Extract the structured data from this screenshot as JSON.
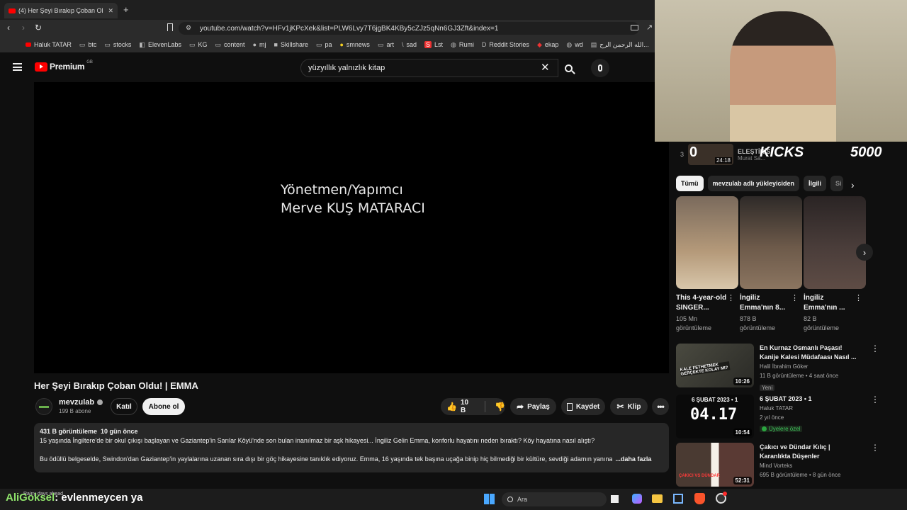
{
  "browser": {
    "tab_title": "(4) Her Şeyi Bırakıp Çoban Ol",
    "url": "youtube.com/watch?v=HFv1jKPcXek&list=PLW6Lvy7T6jgBK4KBy5cZJz5qNn6GJ3Zft&index=1",
    "bookmarks": [
      "Haluk TATAR",
      "btc",
      "stocks",
      "ElevenLabs",
      "KG",
      "content",
      "mj",
      "Skillshare",
      "pa",
      "smnews",
      "art",
      "sad",
      "Lst",
      "Rumi",
      "Reddit Stories",
      "ekap",
      "wd",
      "الله الرحمن الرح..."
    ]
  },
  "header": {
    "logo": "Premium",
    "region": "GB",
    "search_value": "yüzyıllık yalnızlık kitap"
  },
  "video": {
    "credit_line1": "Yönetmen/Yapımcı",
    "credit_line2": "Merve KUŞ MATARACI",
    "title": "Her Şeyi Bırakıp Çoban Oldu! | EMMA",
    "channel": "mevzulab",
    "subscribers": "199 B abone",
    "join": "Katıl",
    "subscribe": "Abone ol",
    "likes": "10 B",
    "share": "Paylaş",
    "save": "Kaydet",
    "clip": "Klip"
  },
  "description": {
    "stats": "431 B görüntüleme  10 gün önce",
    "line1": "15 yaşında İngiltere'de bir okul çıkışı başlayan ve Gaziantep'in Sarılar Köyü'nde son bulan inanılmaz bir aşk hikayesi... İngiliz Gelin Emma, konforlu hayatını neden bıraktı? Köy hayatına nasıl alıştı?",
    "line2": "Bu ödüllü belgeselde, Swindon'dan Gaziantep'in yaylalarına uzanan sıra dışı bir göç hikayesine tanıklık ediyoruz. Emma, 16 yaşında tek başına uçağa binip hiç bilmediği bir kültüre, sevdiği adamın yanına",
    "more": "...daha fazla"
  },
  "sidebar": {
    "top_item": {
      "index": "3",
      "title": "ELEŞTİRİSİ",
      "channel": "Murat Sa...",
      "duration": "24:18"
    },
    "chips": [
      "Tümü",
      "mevzulab adlı yükleyiciden",
      "İlgili",
      "Si"
    ],
    "shorts": [
      {
        "title": "This 4-year-old SINGER...",
        "views": "105 Mn görüntüleme",
        "color": "#b59a7a"
      },
      {
        "title": "İngiliz Emma'nın 8...",
        "views": "878 B görüntüleme",
        "color": "#6d5a4a"
      },
      {
        "title": "İngiliz Emma'nın ...",
        "views": "82 B görüntüleme",
        "color": "#4a3d3a"
      }
    ],
    "videos": [
      {
        "title": "En Kurnaz Osmanlı Paşası! Kanije Kalesi Müdafaası Nasıl ...",
        "channel": "Halil İbrahim Göker",
        "meta": "11 B görüntüleme • 4 saat önce",
        "badge": "Yeni",
        "duration": "10:26",
        "thumb_text": "KALE FETHETMEK GERÇEKTE KOLAY MI?"
      },
      {
        "title": "6 ŞUBAT 2023 • 1",
        "channel": "Haluk TATAR",
        "meta": "2 yıl önce",
        "badge": "Üyelere özel",
        "duration": "10:54",
        "thumb_text": "6 ŞUBAT 2023 • 1",
        "thumb_big": "04.17"
      },
      {
        "title": "Çakıcı ve Dündar Kılıç | Karanlıkta Düşenler",
        "channel": "Mind Vorteks",
        "meta": "695 B görüntüleme • 8 gün önce",
        "badge": "",
        "duration": "52:31",
        "thumb_text": "ÇAKICI VS DÜNDAR"
      }
    ]
  },
  "webcam": {
    "overlay_left": "KICKS",
    "overlay_right": "5000",
    "overlay_zero": "0"
  },
  "taskbar": {
    "notification": "Rainy days ahead",
    "search": "Ara",
    "streamer": "AliGoksel",
    "ticker": ": evlenmeycen ya"
  },
  "colors": {
    "accent_red": "#ff0000",
    "chip_active_bg": "#f1f1f1",
    "member_green": "#2ba640",
    "overlay_green": "#8fe36b"
  }
}
